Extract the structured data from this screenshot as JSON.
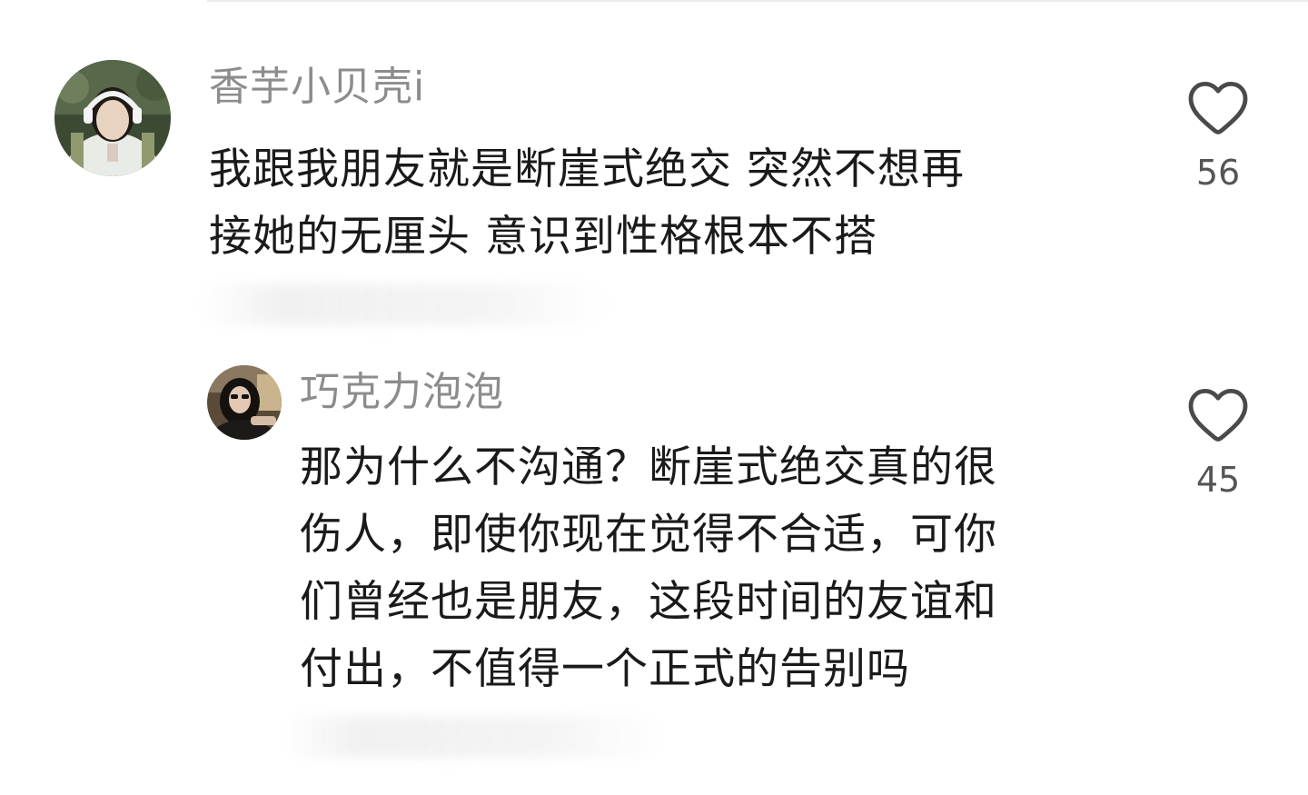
{
  "comments": [
    {
      "username": "香芋小贝壳i",
      "text_lines": [
        "我跟我朋友就是断崖式绝交 突然不想再",
        "接她的无厘头 意识到性格根本不搭"
      ],
      "likes": "56"
    },
    {
      "username": "巧克力泡泡",
      "text_lines": [
        "那为什么不沟通？断崖式绝交真的很",
        "伤人，即使你现在觉得不合适，可你",
        "们曾经也是朋友，这段时间的友谊和",
        "付出，不值得一个正式的告别吗"
      ],
      "likes": "45"
    }
  ]
}
